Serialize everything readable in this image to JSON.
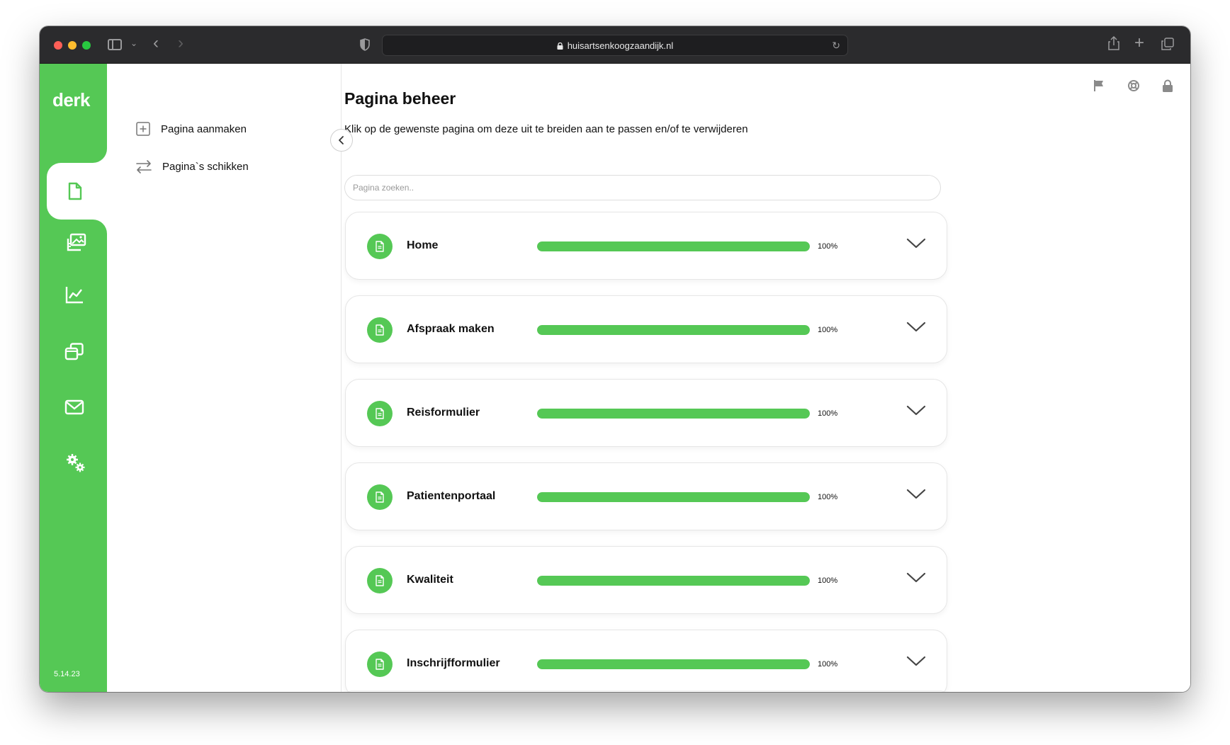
{
  "browser": {
    "url": "huisartsenkoogzaandijk.nl"
  },
  "app": {
    "logo": "derk",
    "version": "5.14.23",
    "accent": "#55c855"
  },
  "rail": {
    "items": [
      {
        "icon": "document-icon",
        "active": true
      },
      {
        "icon": "media-icon",
        "active": false
      },
      {
        "icon": "statistics-icon",
        "active": false
      },
      {
        "icon": "windows-icon",
        "active": false
      },
      {
        "icon": "mail-icon",
        "active": false
      },
      {
        "icon": "settings-icon",
        "active": false
      }
    ]
  },
  "subnav": {
    "items": [
      {
        "label": "Pagina aanmaken",
        "icon": "plus-square-icon"
      },
      {
        "label": "Pagina`s schikken",
        "icon": "swap-arrows-icon"
      }
    ]
  },
  "main": {
    "title": "Pagina beheer",
    "subtitle": "Klik op de gewenste pagina om deze uit te breiden aan te passen en/of te verwijderen",
    "search_placeholder": "Pagina zoeken.."
  },
  "pages": [
    {
      "title": "Home",
      "progress": 100,
      "progress_label": "100%"
    },
    {
      "title": "Afspraak maken",
      "progress": 100,
      "progress_label": "100%"
    },
    {
      "title": "Reisformulier",
      "progress": 100,
      "progress_label": "100%"
    },
    {
      "title": "Patientenportaal",
      "progress": 100,
      "progress_label": "100%"
    },
    {
      "title": "Kwaliteit",
      "progress": 100,
      "progress_label": "100%"
    },
    {
      "title": "Inschrijfformulier",
      "progress": 100,
      "progress_label": "100%"
    }
  ]
}
